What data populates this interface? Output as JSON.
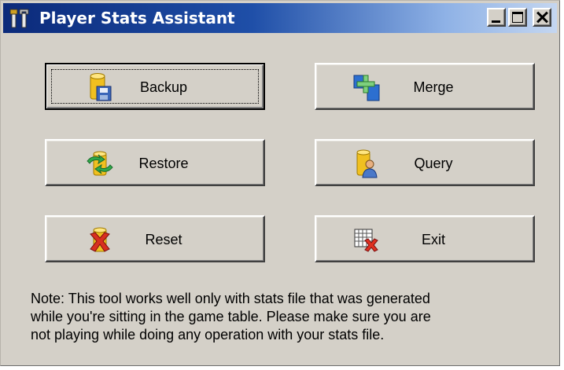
{
  "window": {
    "title": "Player Stats Assistant",
    "title_icon": "tools-icon",
    "controls": [
      "minimize",
      "maximize",
      "close"
    ]
  },
  "buttons": {
    "backup": {
      "label": "Backup",
      "icon": "database-floppy-icon"
    },
    "merge": {
      "label": "Merge",
      "icon": "merge-plus-icon"
    },
    "restore": {
      "label": "Restore",
      "icon": "database-restore-arrows-icon"
    },
    "query": {
      "label": "Query",
      "icon": "database-user-icon"
    },
    "reset": {
      "label": "Reset",
      "icon": "database-delete-icon"
    },
    "exit": {
      "label": "Exit",
      "icon": "grid-close-icon"
    }
  },
  "note": {
    "line1": "Note: This tool works well only with stats file that was generated",
    "line2": "while you're sitting in the game table. Please make sure you are",
    "line3": "not playing while doing any operation with your stats file."
  },
  "colors": {
    "title_gradient_start": "#0b2a7a",
    "title_gradient_end": "#c4d6f0",
    "face": "#d4d0c8"
  }
}
